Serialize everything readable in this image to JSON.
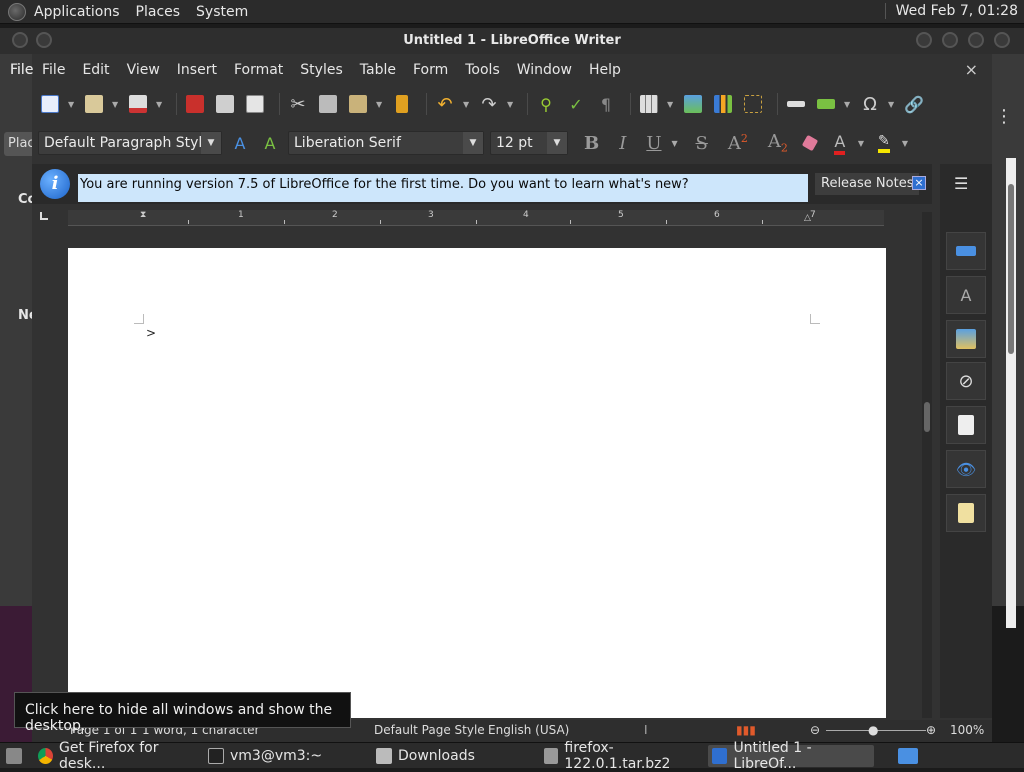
{
  "top_panel": {
    "menus": [
      "Applications",
      "Places",
      "System"
    ],
    "clock": "Wed Feb  7, 01:28"
  },
  "background_window": {
    "file_menu": "File",
    "tab_partial": "Plac",
    "c_partial": "Co",
    "n_partial": "Ne"
  },
  "window": {
    "title": "Untitled 1 - LibreOffice Writer"
  },
  "menubar": {
    "items": [
      "File",
      "Edit",
      "View",
      "Insert",
      "Format",
      "Styles",
      "Table",
      "Form",
      "Tools",
      "Window",
      "Help"
    ],
    "close": "×"
  },
  "format_bar": {
    "paragraph_style": "Default Paragraph Style",
    "font_name": "Liberation Serif",
    "font_size": "12 pt",
    "bold": "B",
    "italic": "I",
    "underline": "U",
    "strike": "S",
    "superscript": "A",
    "subscript": "A"
  },
  "infobar": {
    "message": "You are running version 7.5 of LibreOffice for the first time. Do you want to learn what's new?",
    "button": "Release Notes",
    "close": "×"
  },
  "ruler": {
    "labels": [
      "1",
      "1",
      "2",
      "3",
      "4",
      "5",
      "6",
      "7"
    ]
  },
  "document": {
    "cursor_mark": ">"
  },
  "statusbar": {
    "page": "Page 1 of 1",
    "words": "1 word, 1 character",
    "page_style": "Default Page Style",
    "language": "English (USA)",
    "zoom": "100%"
  },
  "tooltip": {
    "text": "Click here to hide all windows and show the desktop."
  },
  "taskbar": {
    "tasks": [
      {
        "label": "Get Firefox for desk..."
      },
      {
        "label": "vm3@vm3:~"
      },
      {
        "label": "Downloads"
      },
      {
        "label": "firefox-122.0.1.tar.bz2"
      },
      {
        "label": "Untitled 1 - LibreOf..."
      }
    ]
  },
  "colors": {
    "infobar_bg": "#cde6fb",
    "accent_blue": "#2f6fd0",
    "panel_bg": "#2b2b2b",
    "window_bg": "#323232"
  }
}
